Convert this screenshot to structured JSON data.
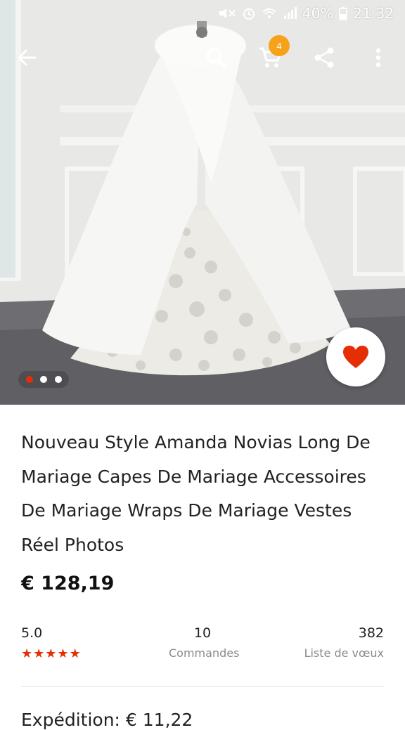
{
  "status_bar": {
    "battery": "40%",
    "time": "21:32"
  },
  "toolbar": {
    "cart_count": "4"
  },
  "product": {
    "title": "Nouveau Style Amanda Novias Long De Mariage Capes De Mariage Accessoires De Mariage Wraps De Mariage Vestes Réel Photos",
    "price": "€ 128,19"
  },
  "carousel": {
    "total": 3,
    "active": 1
  },
  "stats": {
    "rating": "5.0",
    "rating_stars": 5,
    "orders_count": "10",
    "orders_label": "Commandes",
    "wishlist_count": "382",
    "wishlist_label": "Liste de vœux"
  },
  "shipping": {
    "label": "Expédition: € 11,22"
  },
  "colors": {
    "accent_red": "#e62e04",
    "badge_orange": "#f7a21b",
    "label_gray": "#8a8a8a"
  },
  "icons": [
    "back-arrow-icon",
    "search-icon",
    "cart-icon",
    "share-icon",
    "more-vert-icon",
    "heart-icon",
    "star-icon",
    "wifi-icon",
    "signal-icon",
    "battery-icon",
    "mute-icon",
    "alarm-icon"
  ]
}
